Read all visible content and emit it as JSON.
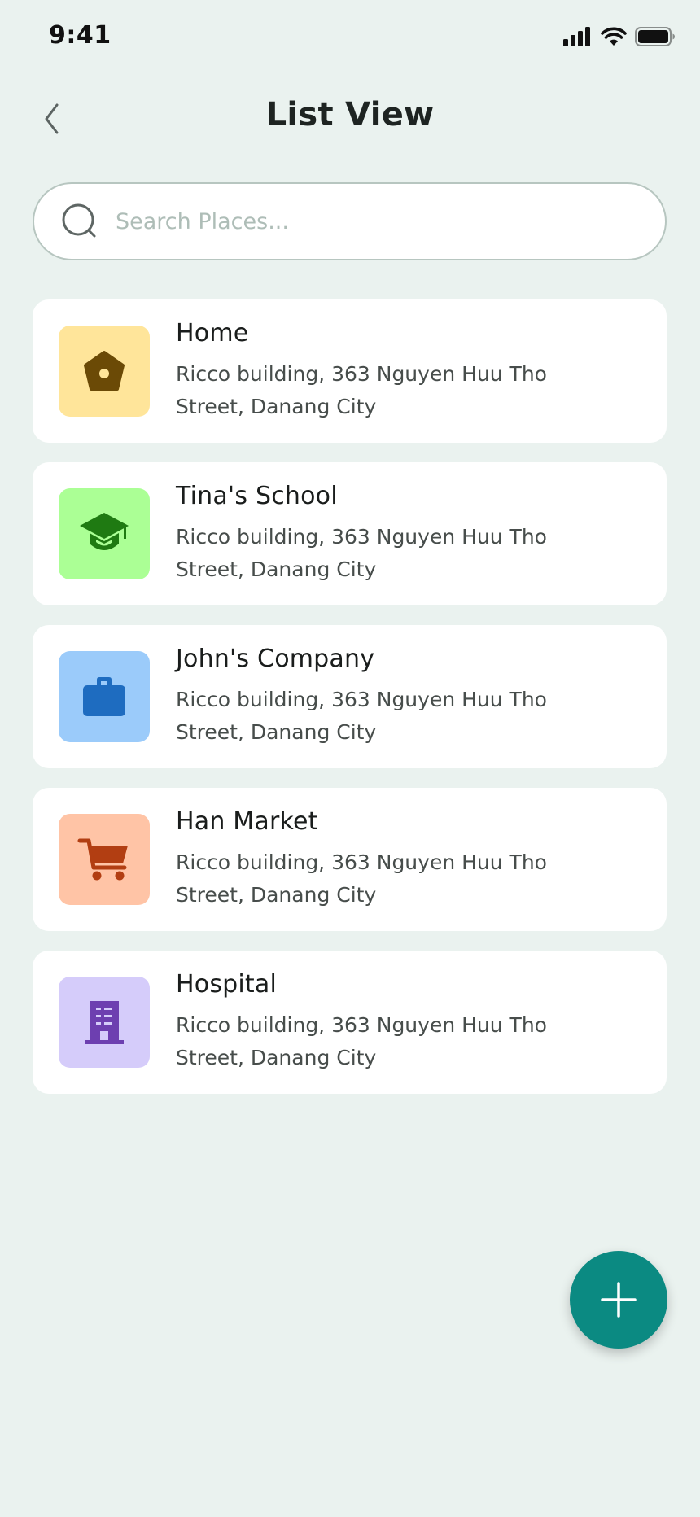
{
  "status_bar": {
    "time": "9:41",
    "icons": [
      "cellular-signal-icon",
      "wifi-icon",
      "battery-icon"
    ]
  },
  "header": {
    "title": "List View",
    "back_icon": "chevron-left-icon"
  },
  "search": {
    "placeholder": "Search Places...",
    "value": "",
    "icon": "search-icon"
  },
  "places": [
    {
      "name": "Home",
      "address": "Ricco building, 363 Nguyen Huu Tho Street, Danang City",
      "icon": "home-icon",
      "tile_color": "#FFE59A",
      "icon_color": "#6B4A06"
    },
    {
      "name": "Tina's School",
      "address": "Ricco building, 363 Nguyen Huu Tho Street, Danang City",
      "icon": "graduation-cap-icon",
      "tile_color": "#ABFF95",
      "icon_color": "#1F7A12"
    },
    {
      "name": "John's Company",
      "address": "Ricco building, 363 Nguyen Huu Tho Street, Danang City",
      "icon": "briefcase-icon",
      "tile_color": "#9BCBFA",
      "icon_color": "#1E6CC0"
    },
    {
      "name": "Han Market",
      "address": "Ricco building, 363 Nguyen Huu Tho Street, Danang City",
      "icon": "shopping-cart-icon",
      "tile_color": "#FFC4A6",
      "icon_color": "#B23E12"
    },
    {
      "name": "Hospital",
      "address": "Ricco building, 363 Nguyen Huu Tho Street, Danang City",
      "icon": "hospital-building-icon",
      "tile_color": "#D5CCFA",
      "icon_color": "#6D3FB0"
    }
  ],
  "fab": {
    "icon": "plus-icon",
    "color": "#0B8A82"
  },
  "colors": {
    "background": "#EAF2EF",
    "card": "#FFFFFF",
    "accent": "#0B8A82"
  }
}
